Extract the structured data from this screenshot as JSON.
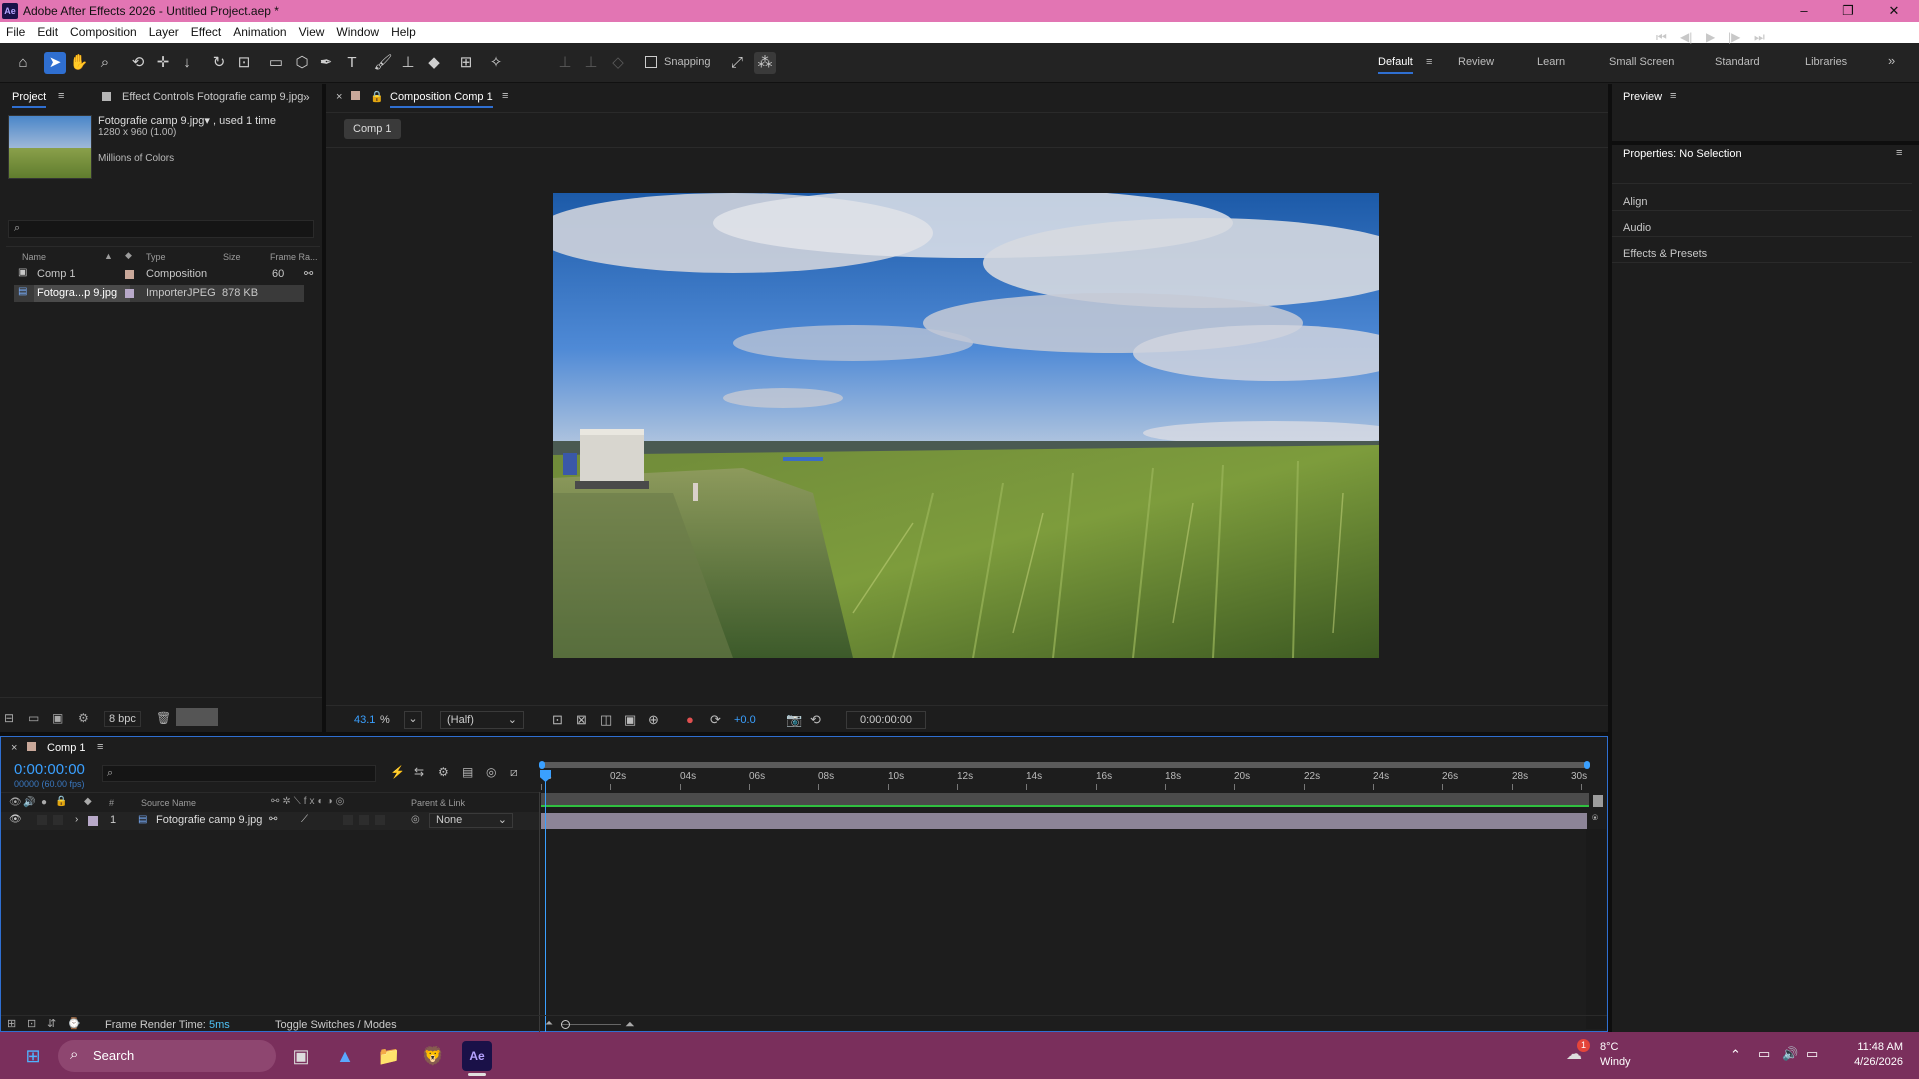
{
  "window": {
    "app_icon": "Ae",
    "title": "Adobe After Effects 2026 - Untitled Project.aep *",
    "minimize": "–",
    "maximize": "❐",
    "close": "✕"
  },
  "menu": [
    "File",
    "Edit",
    "Composition",
    "Layer",
    "Effect",
    "Animation",
    "View",
    "Window",
    "Help"
  ],
  "toolbar": {
    "snapping_label": "Snapping",
    "workspaces": [
      "Default",
      "Review",
      "Learn",
      "Small Screen",
      "Standard",
      "Libraries"
    ],
    "more": "»"
  },
  "project_panel": {
    "tab_project": "Project",
    "tab_effect_controls": "Effect Controls Fotografie camp 9.jpg",
    "asset_name": "Fotografie camp 9.jpg▾ , used 1 time",
    "asset_dims": "1280 x 960 (1.00)",
    "asset_colors": "Millions of Colors",
    "search_placeholder": "",
    "columns": {
      "name": "Name",
      "type": "Type",
      "size": "Size",
      "frame_rate": "Frame Ra..."
    },
    "rows": [
      {
        "name": "Comp 1",
        "type": "Composition",
        "size": "",
        "frame_rate": "60"
      },
      {
        "name": "Fotogra...p 9.jpg",
        "type": "ImporterJPEG",
        "size": "878 KB",
        "frame_rate": ""
      }
    ],
    "bpc": "8 bpc"
  },
  "composition_panel": {
    "tab": "Composition Comp 1",
    "breadcrumb": "Comp 1",
    "zoom": "43.1",
    "zoom_unit": "%",
    "resolution": "(Half)",
    "exposure": "+0.0",
    "timecode": "0:00:00:00"
  },
  "right_panel": {
    "preview": "Preview",
    "properties": "Properties: No Selection",
    "items": [
      "Align",
      "Audio",
      "Effects & Presets"
    ]
  },
  "timeline": {
    "tab": "Comp 1",
    "timecode": "0:00:00:00",
    "frames": "00000 (60.00 fps)",
    "col_source": "Source Name",
    "col_parent": "Parent & Link",
    "col_hash": "#",
    "ticks": [
      "0s",
      "02s",
      "04s",
      "06s",
      "08s",
      "10s",
      "12s",
      "14s",
      "16s",
      "18s",
      "20s",
      "22s",
      "24s",
      "26s",
      "28s",
      "30s"
    ],
    "layer": {
      "index": "1",
      "name": "Fotografie camp 9.jpg",
      "parent": "None"
    },
    "render_time_label": "Frame Render Time:",
    "render_time_value": "5ms",
    "toggle": "Toggle Switches / Modes"
  },
  "taskbar": {
    "search": "Search",
    "weather_temp": "8°C",
    "weather_desc": "Windy",
    "weather_badge": "1",
    "time": "11:48 AM",
    "date": "4/26/2026"
  },
  "colors": {
    "titlebar": "#e275b3",
    "accent_blue": "#2f6fd1",
    "timecode_blue": "#3aa0ff",
    "taskbar": "#7a2f5c",
    "layer_bar": "#8c8497"
  }
}
